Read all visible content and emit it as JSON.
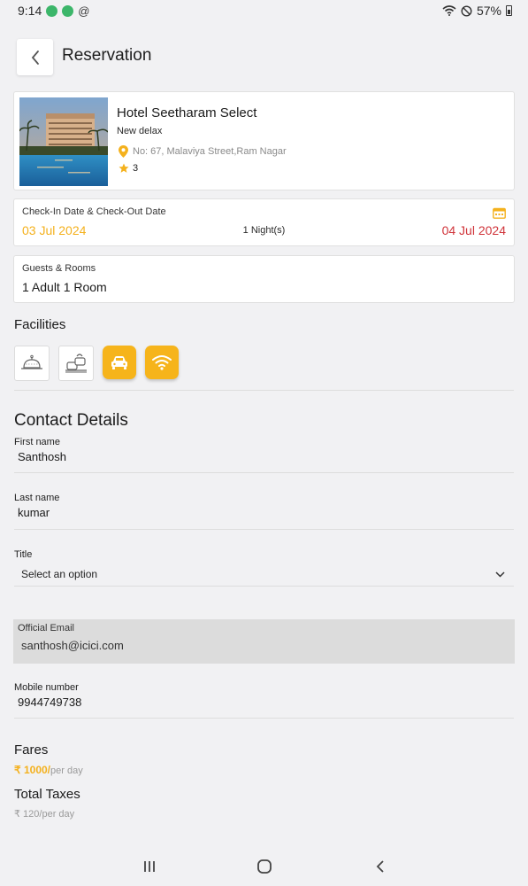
{
  "status_bar": {
    "time": "9:14",
    "battery": "57%",
    "icons": [
      "notification-icon",
      "notification-icon",
      "at-sign-icon",
      "wifi-icon",
      "do-not-disturb-icon",
      "battery-icon"
    ]
  },
  "header": {
    "title": "Reservation",
    "back_icon": "chevron-left-icon"
  },
  "hotel": {
    "name": "Hotel Seetharam Select",
    "room_type": "New delax",
    "address": "No: 67, Malaviya Street,Ram Nagar",
    "rating": "3",
    "location_icon": "location-pin-icon",
    "star_icon": "star-icon"
  },
  "dates": {
    "label": "Check-In Date & Check-Out Date",
    "check_in": "03 Jul 2024",
    "nights": "1 Night(s)",
    "check_out": "04 Jul 2024",
    "icon": "calendar-icon"
  },
  "guests": {
    "label": "Guests & Rooms",
    "value": "1 Adult 1 Room"
  },
  "facilities": {
    "title": "Facilities",
    "items": [
      {
        "icon": "room-service-icon",
        "active": false
      },
      {
        "icon": "laundry-icon",
        "active": false
      },
      {
        "icon": "car-icon",
        "active": true
      },
      {
        "icon": "wifi-icon",
        "active": true
      }
    ]
  },
  "contact": {
    "title": "Contact Details",
    "first_name_label": "First name",
    "first_name": "Santhosh",
    "last_name_label": "Last name",
    "last_name": "kumar",
    "title_label": "Title",
    "title_value": "Select an option",
    "email_label": "Official Email",
    "email": "santhosh@icici.com",
    "mobile_label": "Mobile number",
    "mobile": "9944749738"
  },
  "fares": {
    "title": "Fares",
    "amount": "₹ 1000/",
    "per_day": "per day",
    "taxes_title": "Total Taxes",
    "taxes": "₹ 120/per day"
  },
  "colors": {
    "accent": "#f4b11d",
    "checkout": "#d0343a",
    "facility_active": "#f6b41b"
  }
}
